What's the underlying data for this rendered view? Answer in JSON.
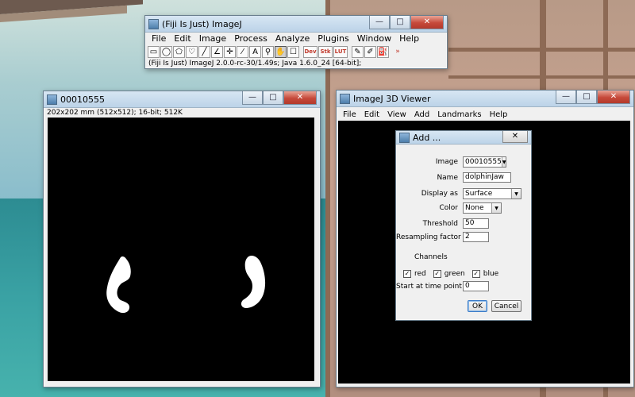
{
  "fiji": {
    "title": "(Fiji Is Just) ImageJ",
    "menus": [
      "File",
      "Edit",
      "Image",
      "Process",
      "Analyze",
      "Plugins",
      "Window",
      "Help"
    ],
    "tools": [
      {
        "name": "rectangle-tool-icon",
        "glyph": "▭",
        "red": false
      },
      {
        "name": "oval-tool-icon",
        "glyph": "◯",
        "red": false
      },
      {
        "name": "polygon-tool-icon",
        "glyph": "⬠",
        "red": false
      },
      {
        "name": "freehand-tool-icon",
        "glyph": "♡",
        "red": false
      },
      {
        "name": "line-tool-icon",
        "glyph": "╱",
        "red": false
      },
      {
        "name": "angle-tool-icon",
        "glyph": "∠",
        "red": false
      },
      {
        "name": "point-tool-icon",
        "glyph": "✛",
        "red": false
      },
      {
        "name": "wand-tool-icon",
        "glyph": "⁄",
        "red": false
      },
      {
        "name": "text-tool-icon",
        "glyph": "A",
        "red": false
      },
      {
        "name": "magnifier-tool-icon",
        "glyph": "⚲",
        "red": false
      },
      {
        "name": "hand-tool-icon",
        "glyph": "✋",
        "red": false,
        "pressed": true
      },
      {
        "name": "color-picker-tool-icon",
        "glyph": "☐",
        "red": false
      }
    ],
    "tools2": [
      {
        "name": "developer-menu-icon",
        "label": "Dev"
      },
      {
        "name": "stack-menu-icon",
        "label": "Stk"
      },
      {
        "name": "lut-menu-icon",
        "label": "LUT"
      }
    ],
    "tools3": [
      {
        "name": "pencil-tool-icon",
        "glyph": "✎"
      },
      {
        "name": "brush-tool-icon",
        "glyph": "✐"
      },
      {
        "name": "flood-fill-tool-icon",
        "glyph": "⛽"
      }
    ],
    "more_glyph": "»",
    "status": "(Fiji Is Just) ImageJ 2.0.0-rc-30/1.49s; Java 1.6.0_24 [64-bit];"
  },
  "image_window": {
    "title": "00010555",
    "info": "202x202 mm (512x512); 16-bit; 512K"
  },
  "viewer": {
    "title": "ImageJ 3D Viewer",
    "menus": [
      "File",
      "Edit",
      "View",
      "Add",
      "Landmarks",
      "Help"
    ]
  },
  "dialog": {
    "title": "Add ...",
    "image_label": "Image",
    "image_value": "00010555",
    "name_label": "Name",
    "name_value": "dolphinJaw",
    "display_label": "Display as",
    "display_value": "Surface",
    "color_label": "Color",
    "color_value": "None",
    "threshold_label": "Threshold",
    "threshold_value": "50",
    "resampling_label": "Resampling factor",
    "resampling_value": "2",
    "channels_label": "Channels",
    "channels": [
      {
        "label": "red",
        "checked": true
      },
      {
        "label": "green",
        "checked": true
      },
      {
        "label": "blue",
        "checked": true
      }
    ],
    "start_label": "Start at time point",
    "start_value": "0",
    "ok_label": "OK",
    "cancel_label": "Cancel"
  },
  "window_buttons": {
    "minimize": "—",
    "maximize": "□",
    "close": "✕"
  },
  "colors": {
    "canvas": "#000000",
    "blob": "#ffffff",
    "accent": "#3a7bc8"
  }
}
